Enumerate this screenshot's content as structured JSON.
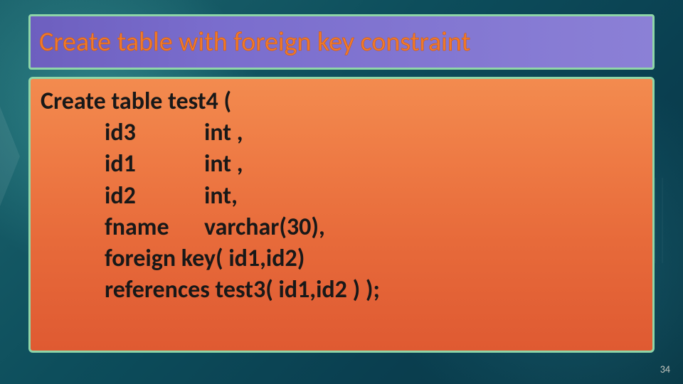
{
  "title": "Create table with foreign key constraint",
  "code": {
    "l1": "Create table test4 (",
    "r1c1": "id3",
    "r1c2": "int ,",
    "r2c1": "id1",
    "r2c2": "int ,",
    "r3c1": "id2",
    "r3c2": "int,",
    "r4c1": "fname",
    "r4c2": "varchar(30),",
    "r5": "foreign key( id1,id2)",
    "r6": "references test3( id1,id2 ) );"
  },
  "page_number": "34"
}
